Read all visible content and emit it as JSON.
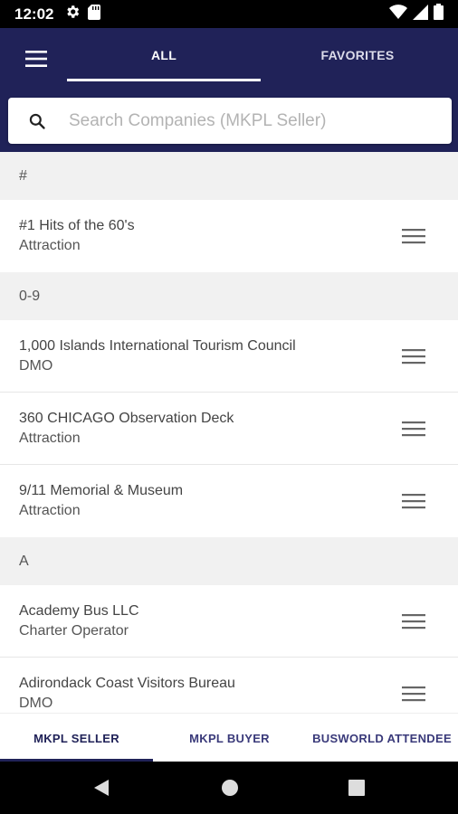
{
  "status_bar": {
    "time": "12:02",
    "icons": [
      "gear-icon",
      "sd-card-icon",
      "wifi-icon",
      "signal-icon",
      "battery-icon"
    ]
  },
  "header": {
    "menu_icon": "hamburger-menu-icon",
    "tabs": [
      {
        "label": "ALL",
        "selected": true
      },
      {
        "label": "FAVORITES",
        "selected": false
      }
    ],
    "background_color": "#202258"
  },
  "search": {
    "placeholder": "Search Companies (MKPL Seller)",
    "value": "",
    "icon": "search-icon"
  },
  "list": {
    "sections": [
      {
        "header": "#",
        "items": [
          {
            "name": "#1 Hits of the 60's",
            "type": "Attraction"
          }
        ]
      },
      {
        "header": "0-9",
        "items": [
          {
            "name": "1,000 Islands International Tourism Council",
            "type": "DMO"
          },
          {
            "name": "360 CHICAGO Observation Deck",
            "type": "Attraction"
          },
          {
            "name": "9/11 Memorial & Museum",
            "type": "Attraction"
          }
        ]
      },
      {
        "header": "A",
        "items": [
          {
            "name": "Academy Bus LLC",
            "type": "Charter Operator"
          },
          {
            "name": "Adirondack Coast Visitors Bureau",
            "type": "DMO"
          }
        ]
      }
    ],
    "item_menu_icon": "drag-handle-icon"
  },
  "bottom_tabs": [
    {
      "label": "MKPL SELLER",
      "selected": true
    },
    {
      "label": "MKPL BUYER",
      "selected": false
    },
    {
      "label": "BUSWORLD ATTENDEE",
      "selected": false
    }
  ],
  "nav_bar": {
    "buttons": [
      "back-icon",
      "home-icon",
      "recents-icon"
    ]
  }
}
